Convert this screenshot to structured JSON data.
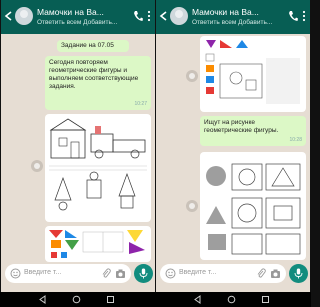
{
  "left": {
    "header": {
      "title": "Мамочки на Ва...",
      "subtitle": "Ответить всем  Добавить..."
    },
    "messages": {
      "task": "Задание на 07.05",
      "text": "Сегодня повторяем геометрические фигуры и выполняем соответствующие задания.",
      "time": "10:27"
    },
    "input": {
      "placeholder": "Введите т..."
    }
  },
  "right": {
    "header": {
      "title": "Мамочки на Ва...",
      "subtitle": "Ответить всем  Добавить..."
    },
    "messages": {
      "text": "Ищут на рисунке геометрические фигуры.",
      "time": "10:28"
    },
    "input": {
      "placeholder": "Введите т..."
    }
  },
  "colors": {
    "header": "#075e54",
    "bubble": "#dcf8c6",
    "chat_bg": "#e6ddd3",
    "accent": "#128c7e"
  },
  "icons": [
    "back-arrow-icon",
    "avatar",
    "call-icon",
    "more-icon",
    "emoji-icon",
    "attach-icon",
    "camera-icon",
    "mic-icon",
    "share-icon",
    "nav-back-icon",
    "nav-home-icon",
    "nav-recent-icon"
  ]
}
